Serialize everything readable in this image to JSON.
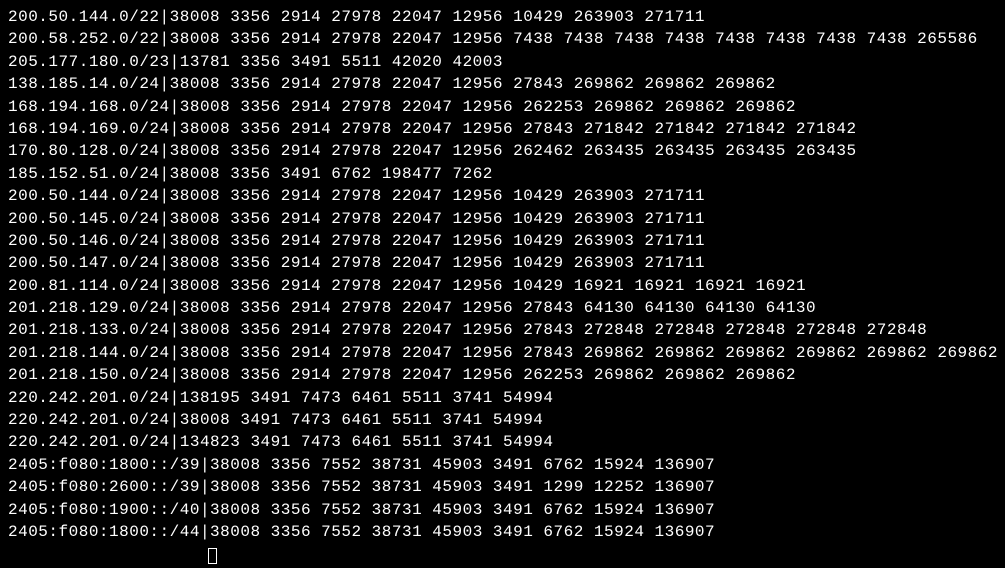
{
  "separator": "|",
  "routes": [
    {
      "prefix": "200.50.144.0/22",
      "as_path": "38008 3356 2914 27978 22047 12956 10429 263903 271711"
    },
    {
      "prefix": "200.58.252.0/22",
      "as_path": "38008 3356 2914 27978 22047 12956 7438 7438 7438 7438 7438 7438 7438 7438 265586"
    },
    {
      "prefix": "205.177.180.0/23",
      "as_path": "13781 3356 3491 5511 42020 42003"
    },
    {
      "prefix": "138.185.14.0/24",
      "as_path": "38008 3356 2914 27978 22047 12956 27843 269862 269862 269862"
    },
    {
      "prefix": "168.194.168.0/24",
      "as_path": "38008 3356 2914 27978 22047 12956 262253 269862 269862 269862"
    },
    {
      "prefix": "168.194.169.0/24",
      "as_path": "38008 3356 2914 27978 22047 12956 27843 271842 271842 271842 271842"
    },
    {
      "prefix": "170.80.128.0/24",
      "as_path": "38008 3356 2914 27978 22047 12956 262462 263435 263435 263435 263435"
    },
    {
      "prefix": "185.152.51.0/24",
      "as_path": "38008 3356 3491 6762 198477 7262"
    },
    {
      "prefix": "200.50.144.0/24",
      "as_path": "38008 3356 2914 27978 22047 12956 10429 263903 271711"
    },
    {
      "prefix": "200.50.145.0/24",
      "as_path": "38008 3356 2914 27978 22047 12956 10429 263903 271711"
    },
    {
      "prefix": "200.50.146.0/24",
      "as_path": "38008 3356 2914 27978 22047 12956 10429 263903 271711"
    },
    {
      "prefix": "200.50.147.0/24",
      "as_path": "38008 3356 2914 27978 22047 12956 10429 263903 271711"
    },
    {
      "prefix": "200.81.114.0/24",
      "as_path": "38008 3356 2914 27978 22047 12956 10429 16921 16921 16921 16921"
    },
    {
      "prefix": "201.218.129.0/24",
      "as_path": "38008 3356 2914 27978 22047 12956 27843 64130 64130 64130 64130"
    },
    {
      "prefix": "201.218.133.0/24",
      "as_path": "38008 3356 2914 27978 22047 12956 27843 272848 272848 272848 272848 272848"
    },
    {
      "prefix": "201.218.144.0/24",
      "as_path": "38008 3356 2914 27978 22047 12956 27843 269862 269862 269862 269862 269862 269862"
    },
    {
      "prefix": "201.218.150.0/24",
      "as_path": "38008 3356 2914 27978 22047 12956 262253 269862 269862 269862"
    },
    {
      "prefix": "220.242.201.0/24",
      "as_path": "138195 3491 7473 6461 5511 3741 54994"
    },
    {
      "prefix": "220.242.201.0/24",
      "as_path": "38008 3491 7473 6461 5511 3741 54994"
    },
    {
      "prefix": "220.242.201.0/24",
      "as_path": "134823 3491 7473 6461 5511 3741 54994"
    },
    {
      "prefix": "2405:f080:1800::/39",
      "as_path": "38008 3356 7552 38731 45903 3491 6762 15924 136907"
    },
    {
      "prefix": "2405:f080:2600::/39",
      "as_path": "38008 3356 7552 38731 45903 3491 1299 12252 136907"
    },
    {
      "prefix": "2405:f080:1900::/40",
      "as_path": "38008 3356 7552 38731 45903 3491 6762 15924 136907"
    },
    {
      "prefix": "2405:f080:1800::/44",
      "as_path": "38008 3356 7552 38731 45903 3491 6762 15924 136907"
    }
  ]
}
